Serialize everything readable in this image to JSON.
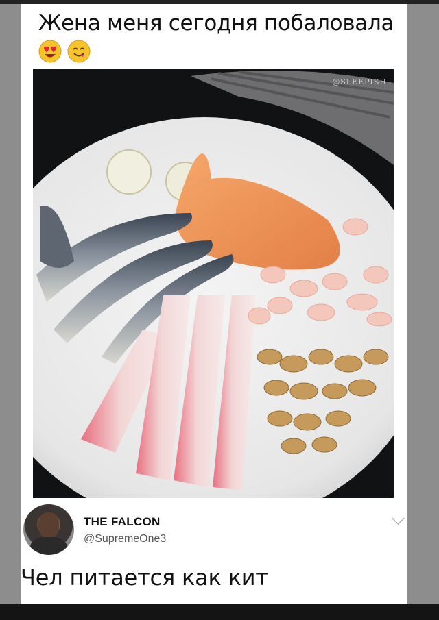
{
  "post": {
    "caption": "Жена меня сегодня побаловала",
    "emojis": [
      "heart-eyes-emoji",
      "yum-face-emoji"
    ],
    "photo_watermark": "@SLEEPISH"
  },
  "tweet": {
    "author_name": "THE FALCON",
    "author_handle": "@SupremeOne3",
    "reply_text": "Чел питается как кит"
  },
  "colors": {
    "background": "#8d8d8d",
    "card": "#ffffff",
    "text": "#111111",
    "handle": "#555555"
  }
}
